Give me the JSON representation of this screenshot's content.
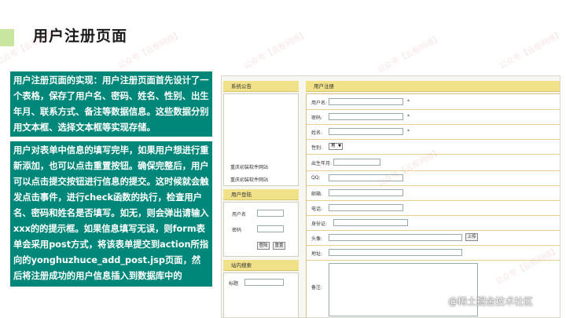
{
  "slide": {
    "title": "用户注册页面",
    "card1_text": "用户注册页面的实现：用户注册页面首先设计了一个表格，保存了用户名、密码、姓名、性别、出生年月、联系方式、备注等数据信息。这些数据分别用文本框、选择文本框等实现存储。",
    "card2_text": "用户对表单中信息的填写完毕，如果用户想进行重新添加，也可以点击重置按钮。确保完整后，用户可以点击提交按钮进行信息的提交。这时候就会触发点击事件，进行check函数的执行，检查用户名、密码和姓名是否填写。如无，则会弹出请输入xxx的的提示框。如果信息填写无误，则form表单会采用post方式，将该表单提交到action所指向的yonghuzhuce_add_post.jsp页面，然后将注册成功的用户信息插入到数据库中的yonghuzhuce表中。",
    "watermark": "公众号【云枢网络】",
    "footer": "@稀土掘金技术社区"
  },
  "screenshot": {
    "sidebar": {
      "announcement_title": "系统公告",
      "announcement_link1": "重庆初装软件网站",
      "announcement_link2": "重庆初装软件网站",
      "login_title": "用户登陆",
      "username_label": "用户名",
      "password_label": "密码",
      "login_button": "登陆",
      "reset_button": "重置",
      "search_title": "站内搜索",
      "search_label": "标题"
    },
    "register": {
      "header": "用户注册",
      "fields": [
        {
          "label": "用户名:",
          "required": "*"
        },
        {
          "label": "密码:",
          "required": "*"
        },
        {
          "label": "姓名:",
          "required": "*"
        },
        {
          "label": "性别:",
          "required": ""
        },
        {
          "label": "出生年月:",
          "required": ""
        },
        {
          "label": "QQ:",
          "required": ""
        },
        {
          "label": "邮箱:",
          "required": ""
        },
        {
          "label": "电话:",
          "required": ""
        },
        {
          "label": "身份证:",
          "required": ""
        },
        {
          "label": "头像:",
          "required": ""
        },
        {
          "label": "地址:",
          "required": ""
        },
        {
          "label": "备注:",
          "required": ""
        }
      ],
      "gender_value": "男",
      "upload_button": "上传"
    }
  }
}
